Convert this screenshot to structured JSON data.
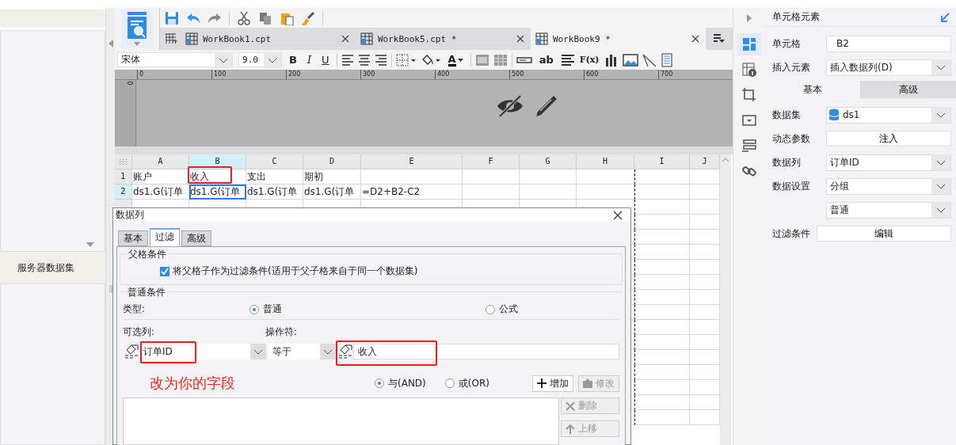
{
  "left_panel": {
    "section_title": "服务器数据集"
  },
  "workbook_tabs": [
    {
      "label": "WorkBook1.cpt",
      "selected": false
    },
    {
      "label": "WorkBook5.cpt *",
      "selected": false
    },
    {
      "label": "WorkBook9 *",
      "selected": true
    }
  ],
  "format_bar": {
    "font": "宋体",
    "size": "9.0",
    "style_buttons": [
      "B",
      "I",
      "U"
    ],
    "font_color_button": "A",
    "text_buttons": [
      "ab",
      "F(x)"
    ]
  },
  "ruler": {
    "marks": [
      "0",
      "100",
      "200",
      "300",
      "400",
      "500",
      "600",
      "700"
    ],
    "vertical_mark": "0"
  },
  "sheet": {
    "columns": [
      {
        "label": "A",
        "selected": false
      },
      {
        "label": "B",
        "selected": true
      },
      {
        "label": "C",
        "selected": false
      },
      {
        "label": "D",
        "selected": false
      },
      {
        "label": "E",
        "selected": false
      },
      {
        "label": "F",
        "selected": false
      },
      {
        "label": "G",
        "selected": false
      },
      {
        "label": "H",
        "selected": false
      },
      {
        "label": "I",
        "selected": false
      },
      {
        "label": "J",
        "selected": false
      }
    ],
    "rows": [
      {
        "label": "1",
        "selected": false,
        "cells": [
          {
            "text": "账户",
            "selected": false
          },
          {
            "text": "收入",
            "selected": false
          },
          {
            "text": "支出",
            "selected": false
          },
          {
            "text": "期初",
            "selected": false
          }
        ]
      },
      {
        "label": "2",
        "selected": true,
        "cells": [
          {
            "text": "ds1.G(订单",
            "selected": false
          },
          {
            "text": "ds1.G(订单",
            "selected": true
          },
          {
            "text": "ds1.G(订单",
            "selected": false
          },
          {
            "text": "ds1.G(订单",
            "selected": false
          },
          {
            "text": "=D2+B2-C2",
            "selected": false
          }
        ]
      }
    ]
  },
  "dialog": {
    "title": "数据列",
    "tabs": [
      {
        "label": "基本",
        "selected": false
      },
      {
        "label": "过滤",
        "selected": true
      },
      {
        "label": "高级",
        "selected": false
      }
    ],
    "parent_group": {
      "title": "父格条件",
      "checkbox": {
        "label": "将父格子作为过滤条件(适用于父子格来自于同一个数据集)",
        "checked": true
      }
    },
    "normal_group": {
      "title": "普通条件",
      "type_label": "类型:",
      "type_options": [
        {
          "label": "普通",
          "selected": true
        },
        {
          "label": "公式",
          "selected": false
        }
      ],
      "column_label": "可选列:",
      "operator_label": "操作符:",
      "column_value": "订单ID",
      "operator_value": "等于",
      "value": "收入",
      "logic_options": [
        {
          "label": "与(AND)",
          "selected": true
        },
        {
          "label": "或(OR)",
          "selected": false
        }
      ],
      "buttons": [
        {
          "label": "增加",
          "kind": "add",
          "disabled": false
        },
        {
          "label": "修改",
          "kind": "edit",
          "disabled": true
        }
      ],
      "side_buttons": [
        {
          "label": "删除",
          "kind": "delete",
          "disabled": true
        },
        {
          "label": "上移",
          "kind": "up",
          "disabled": true
        }
      ]
    }
  },
  "annotation": {
    "text": "改为你的字段"
  },
  "right_panel": {
    "title": "单元格元素",
    "cell_label": "单元格",
    "cell_value": "B2",
    "insert_label": "插入元素",
    "insert_value": "插入数据列(D)",
    "tabs": [
      {
        "label": "基本",
        "selected": true
      },
      {
        "label": "高级",
        "selected": false
      }
    ],
    "rows": [
      {
        "kind": "select",
        "label": "数据集",
        "value": "ds1",
        "icon": true
      },
      {
        "kind": "button",
        "label": "动态参数",
        "value": "注入"
      },
      {
        "kind": "select",
        "label": "数据列",
        "value": "订单ID"
      },
      {
        "kind": "select",
        "label": "数据设置",
        "value": "分组"
      },
      {
        "kind": "select",
        "value": "普通"
      },
      {
        "kind": "wide_button",
        "label": "过滤条件",
        "value": "编辑"
      }
    ]
  }
}
